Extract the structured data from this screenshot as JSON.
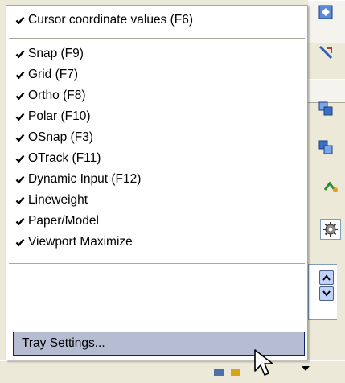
{
  "menu": {
    "items": [
      {
        "label": "Cursor coordinate values (F6)",
        "checked": true
      },
      {
        "label": "Snap (F9)",
        "checked": true
      },
      {
        "label": "Grid (F7)",
        "checked": true
      },
      {
        "label": "Ortho (F8)",
        "checked": true
      },
      {
        "label": "Polar (F10)",
        "checked": true
      },
      {
        "label": "OSnap (F3)",
        "checked": true
      },
      {
        "label": "OTrack (F11)",
        "checked": true
      },
      {
        "label": "Dynamic Input (F12)",
        "checked": true
      },
      {
        "label": "Lineweight",
        "checked": true
      },
      {
        "label": "Paper/Model",
        "checked": true
      },
      {
        "label": "Viewport Maximize",
        "checked": true
      }
    ],
    "footer_item": {
      "label": "Tray Settings...",
      "highlighted": true
    }
  },
  "icons": {
    "check": "checkmark-icon",
    "cursor": "arrow-cursor-icon",
    "tray_expand": "triangle-down-icon"
  },
  "colors": {
    "menu_bg": "#ffffff",
    "highlight_bg": "#b6bdd2",
    "highlight_border": "#0a246a",
    "window_bg": "#ece9d8"
  }
}
